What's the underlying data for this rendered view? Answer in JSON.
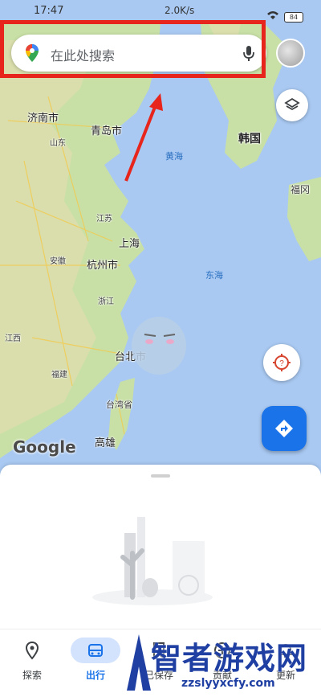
{
  "status_bar": {
    "time": "17:47",
    "mid_text": "2.0K/s",
    "battery": "84"
  },
  "search": {
    "placeholder": "在此处搜索"
  },
  "map": {
    "labels": {
      "jinan": "济南市",
      "shandong": "山东",
      "qingdao": "青岛市",
      "huanghai": "黄海",
      "korea": "韩国",
      "fukuoka": "福冈",
      "jiangsu": "江苏",
      "shanghai": "上海",
      "anhui": "安徽",
      "hangzhou": "杭州市",
      "donghai": "东海",
      "zhejiang": "浙江",
      "jiangxi": "江西",
      "fujian": "福建",
      "taipei": "台北市",
      "taiwan": "台湾省",
      "kaohsiung": "高雄"
    },
    "google_logo": "Google",
    "colors": {
      "sea": "#a9c9f2",
      "land": "#c8e0a6",
      "land_alt": "#f3e9c6",
      "highlight": "#e8251c"
    }
  },
  "buttons": {
    "layers_icon": "layers-icon",
    "locate_icon": "compass-icon",
    "directions_icon": "directions-icon"
  },
  "bottom_nav": {
    "items": [
      {
        "label": "探索",
        "icon": "pin-icon"
      },
      {
        "label": "出行",
        "icon": "car-icon"
      },
      {
        "label": "已保存",
        "icon": "bookmark-icon"
      },
      {
        "label": "贡献",
        "icon": "add-circle-icon"
      },
      {
        "label": "更新",
        "icon": "bell-icon"
      }
    ]
  },
  "watermark": {
    "text": "智者游戏网",
    "url": "zzslyyxcfy.com"
  }
}
